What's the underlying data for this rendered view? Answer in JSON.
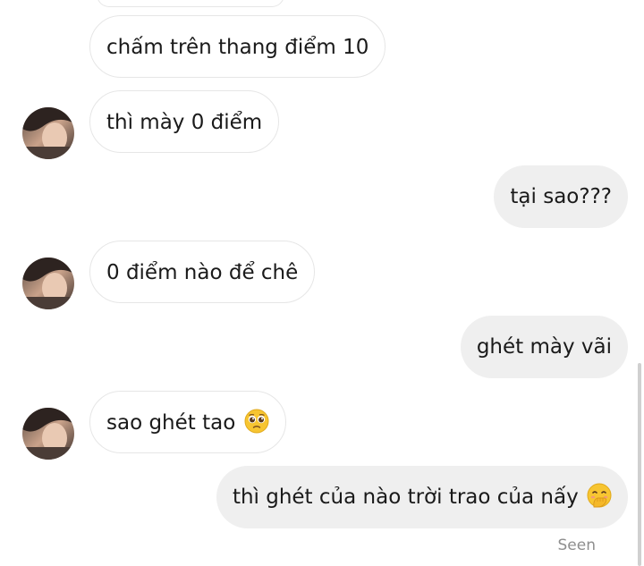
{
  "messages": [
    {
      "id": "m1",
      "direction": "incoming",
      "text": "chấm trên thang điểm 10",
      "avatar": false
    },
    {
      "id": "m2",
      "direction": "incoming",
      "text": "thì mày 0 điểm",
      "avatar": true
    },
    {
      "id": "m3",
      "direction": "outgoing",
      "text": "tại sao???"
    },
    {
      "id": "m4",
      "direction": "incoming",
      "text": "0 điểm nào để chê",
      "avatar": true
    },
    {
      "id": "m5",
      "direction": "outgoing",
      "text": "ghét mày vãi"
    },
    {
      "id": "m6",
      "direction": "incoming",
      "text": "sao ghét tao",
      "emoji": "pleading-face-emoji",
      "avatar": true
    },
    {
      "id": "m7",
      "direction": "outgoing",
      "text": "thì ghét của nào trời trao của nấy",
      "emoji": "face-with-hand-over-mouth-emoji"
    }
  ],
  "status": {
    "seen": "Seen"
  },
  "colors": {
    "outgoing_bubble": "#efefef",
    "incoming_border": "#e6e6e6",
    "seen_text": "#8e8e8e",
    "emoji_yellow": "#f7c531"
  }
}
